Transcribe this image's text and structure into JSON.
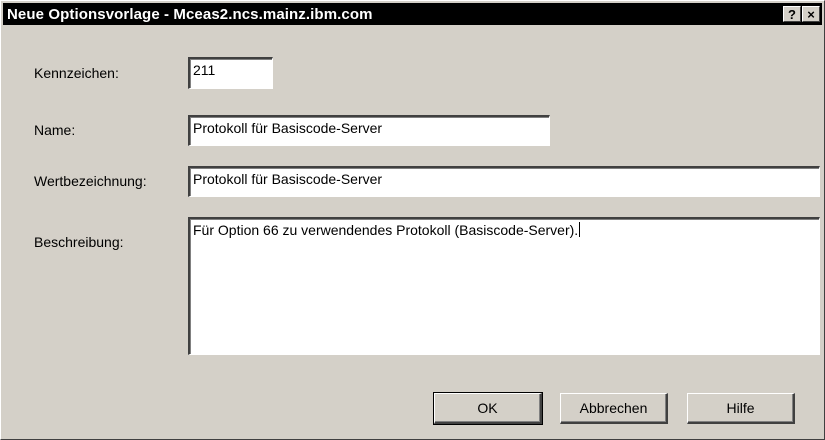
{
  "window": {
    "title": "Neue Optionsvorlage - Mceas2.ncs.mainz.ibm.com",
    "help_button": "?",
    "close_button": "×"
  },
  "form": {
    "kennzeichen": {
      "label": "Kennzeichen:",
      "value": "211"
    },
    "name": {
      "label": "Name:",
      "value": "Protokoll für Basiscode-Server"
    },
    "wertbezeichnung": {
      "label": "Wertbezeichnung:",
      "value": "Protokoll für Basiscode-Server"
    },
    "beschreibung": {
      "label": "Beschreibung:",
      "value": "Für Option 66 zu verwendendes Protokoll (Basiscode-Server)."
    }
  },
  "buttons": {
    "ok": "OK",
    "cancel": "Abbrechen",
    "help": "Hilfe"
  }
}
